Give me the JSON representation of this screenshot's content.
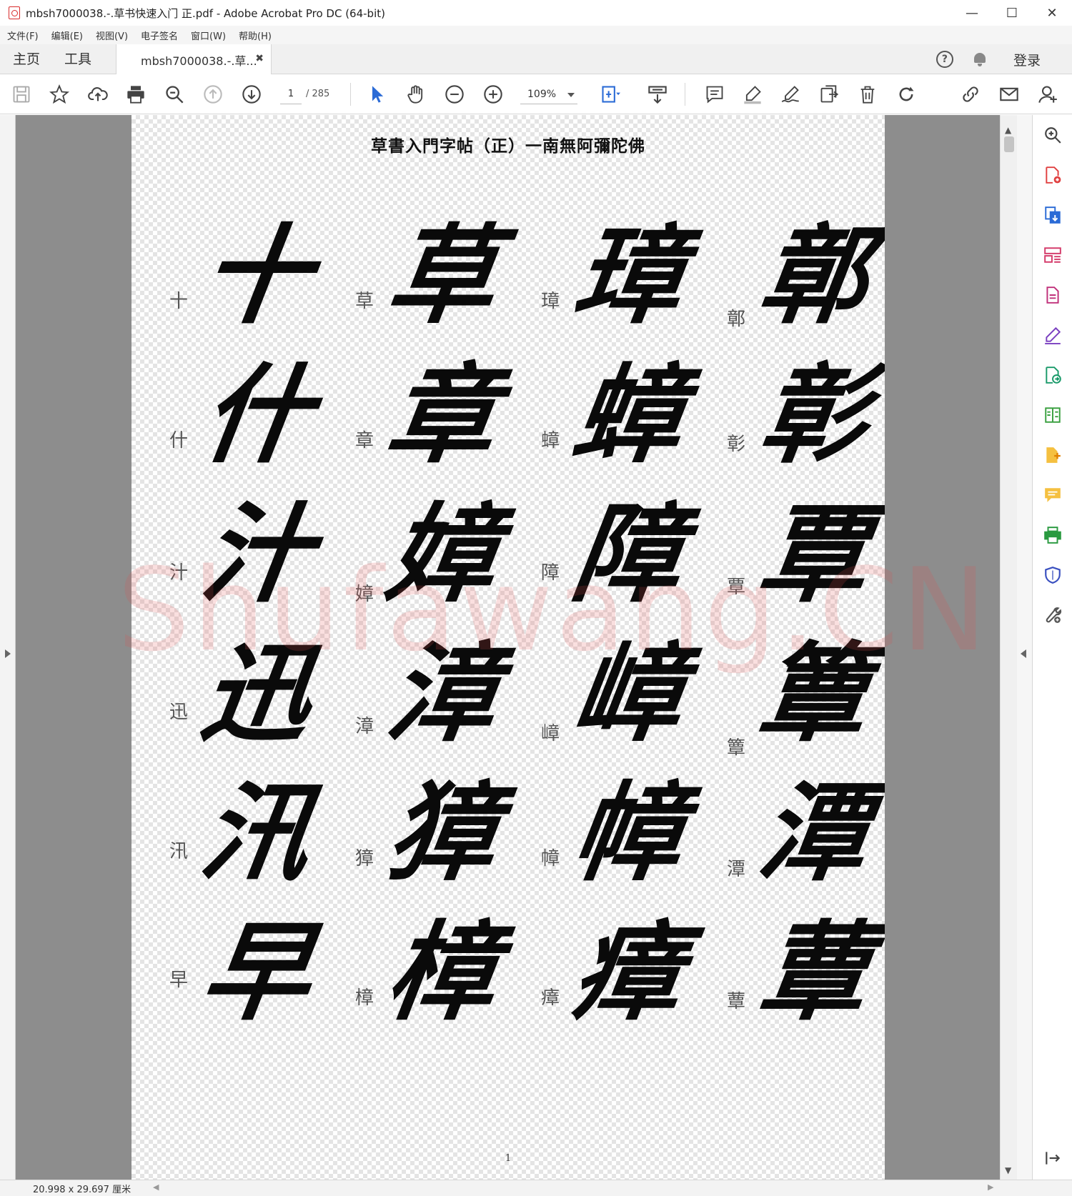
{
  "window": {
    "title": "mbsh7000038.-.草书快速入门 正.pdf - Adobe Acrobat Pro DC (64-bit)",
    "minimize": "—",
    "maximize": "☐",
    "close": "✕"
  },
  "menu": [
    "文件(F)",
    "编辑(E)",
    "视图(V)",
    "电子签名",
    "窗口(W)",
    "帮助(H)"
  ],
  "tabs": {
    "home": "主页",
    "tools": "工具",
    "document": "mbsh7000038.-.草...",
    "close": "✖"
  },
  "header": {
    "help": "?",
    "login": "登录"
  },
  "toolbar": {
    "page_current": "1",
    "page_total": "/ 285",
    "zoom": "109%"
  },
  "document": {
    "title": "草書入門字帖（正）一南無阿彌陀佛",
    "page_number": "1",
    "watermark": "Shufawang.CN",
    "columns": [
      [
        {
          "label": "十",
          "glyph": "十"
        },
        {
          "label": "什",
          "glyph": "什"
        },
        {
          "label": "汁",
          "glyph": "汁"
        },
        {
          "label": "迅",
          "glyph": "迅"
        },
        {
          "label": "汛",
          "glyph": "汛"
        },
        {
          "label": "早",
          "glyph": "早"
        }
      ],
      [
        {
          "label": "草",
          "glyph": "草"
        },
        {
          "label": "章",
          "glyph": "章"
        },
        {
          "label": "嫜",
          "glyph": "嫜"
        },
        {
          "label": "漳",
          "glyph": "漳"
        },
        {
          "label": "獐",
          "glyph": "獐"
        },
        {
          "label": "樟",
          "glyph": "樟"
        }
      ],
      [
        {
          "label": "璋",
          "glyph": "璋"
        },
        {
          "label": "蟑",
          "glyph": "蟑"
        },
        {
          "label": "障",
          "glyph": "障"
        },
        {
          "label": "嶂",
          "glyph": "嶂"
        },
        {
          "label": "幛",
          "glyph": "幛"
        },
        {
          "label": "瘴",
          "glyph": "瘴"
        }
      ],
      [
        {
          "label": "鄣",
          "glyph": "鄣"
        },
        {
          "label": "彰",
          "glyph": "彰"
        },
        {
          "label": "覃",
          "glyph": "覃"
        },
        {
          "label": "簟",
          "glyph": "簟"
        },
        {
          "label": "潭",
          "glyph": "潭"
        },
        {
          "label": "蕈",
          "glyph": "蕈"
        }
      ]
    ]
  },
  "status": {
    "dimensions": "20.998 x 29.697 厘米"
  }
}
